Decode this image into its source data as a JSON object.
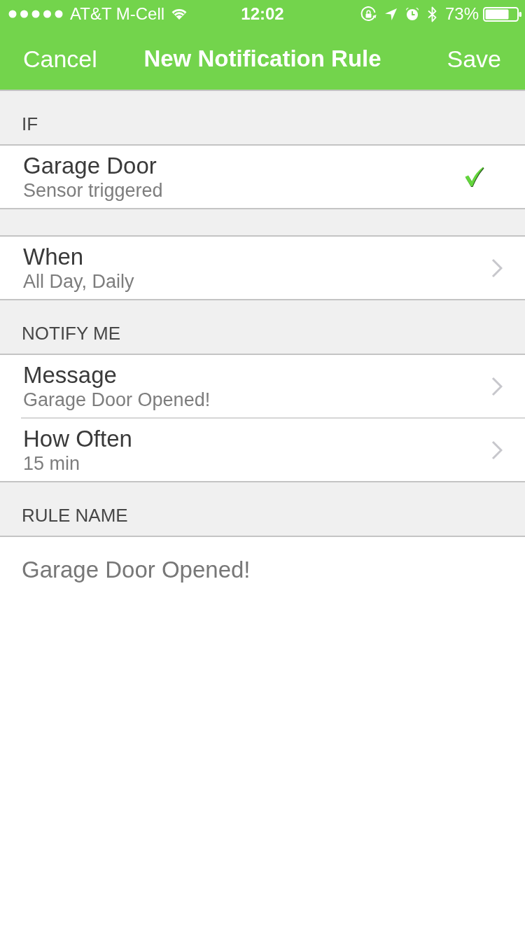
{
  "status_bar": {
    "carrier": "AT&T M-Cell",
    "time": "12:02",
    "battery": "73%"
  },
  "nav_bar": {
    "left_button": "Cancel",
    "title": "New Notification Rule",
    "right_button": "Save"
  },
  "sections": [
    {
      "header": "IF",
      "rows": [
        {
          "kind": "check",
          "title": "Garage Door",
          "subtitle": "Sensor triggered",
          "checked": true
        }
      ]
    },
    {
      "rows": [
        {
          "kind": "disclosure",
          "title": "When",
          "subtitle": "All Day, Daily"
        }
      ]
    },
    {
      "header": "NOTIFY ME",
      "rows": [
        {
          "kind": "disclosure",
          "title": "Message",
          "subtitle": "Garage Door Opened!"
        },
        {
          "kind": "disclosure",
          "title": "How Often",
          "subtitle": "15 min"
        }
      ]
    }
  ],
  "rule_name": {
    "header": "RULE NAME",
    "value": "Garage Door Opened!"
  }
}
